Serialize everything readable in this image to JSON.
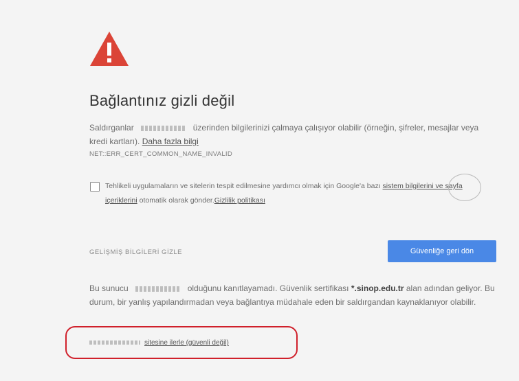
{
  "colors": {
    "warning": "#db4437",
    "primary_button": "#4a88e6",
    "annotation": "#d0202b",
    "background": "#f4f4f4"
  },
  "icons": {
    "warning": "warning-triangle-icon"
  },
  "interstitial": {
    "title": "Bağlantınız gizli değil",
    "desc_before_host": "Saldırganlar",
    "desc_after_host": "üzerinden bilgilerinizi çalmaya çalışıyor olabilir (örneğin, şifreler, mesajlar veya kredi kartları).",
    "learn_more_link": "Daha fazla bilgi",
    "error_code": "NET::ERR_CERT_COMMON_NAME_INVALID",
    "optin": {
      "text_before": "Tehlikeli uygulamaların ve sitelerin tespit edilmesine yardımcı olmak için Google'a bazı",
      "system_info_link": "sistem bilgilerini ve sayfa içeriklerini",
      "text_middle": "otomatik olarak gönder.",
      "privacy_link": "Gizlilik politikası"
    },
    "details_button": "GELİŞMİŞ BİLGİLERİ GİZLE",
    "back_button": "Güvenliğe geri dön",
    "details": {
      "prefix": "Bu sunucu",
      "middle": "olduğunu kanıtlayamadı. Güvenlik sertifikası",
      "cert_domain": "*.sinop.edu.tr",
      "suffix": "alan adından geliyor. Bu durum, bir yanlış yapılandırmadan veya bağlantıya müdahale eden bir saldırgandan kaynaklanıyor olabilir."
    },
    "proceed_link": "sitesine ilerle (güvenli değil)"
  }
}
